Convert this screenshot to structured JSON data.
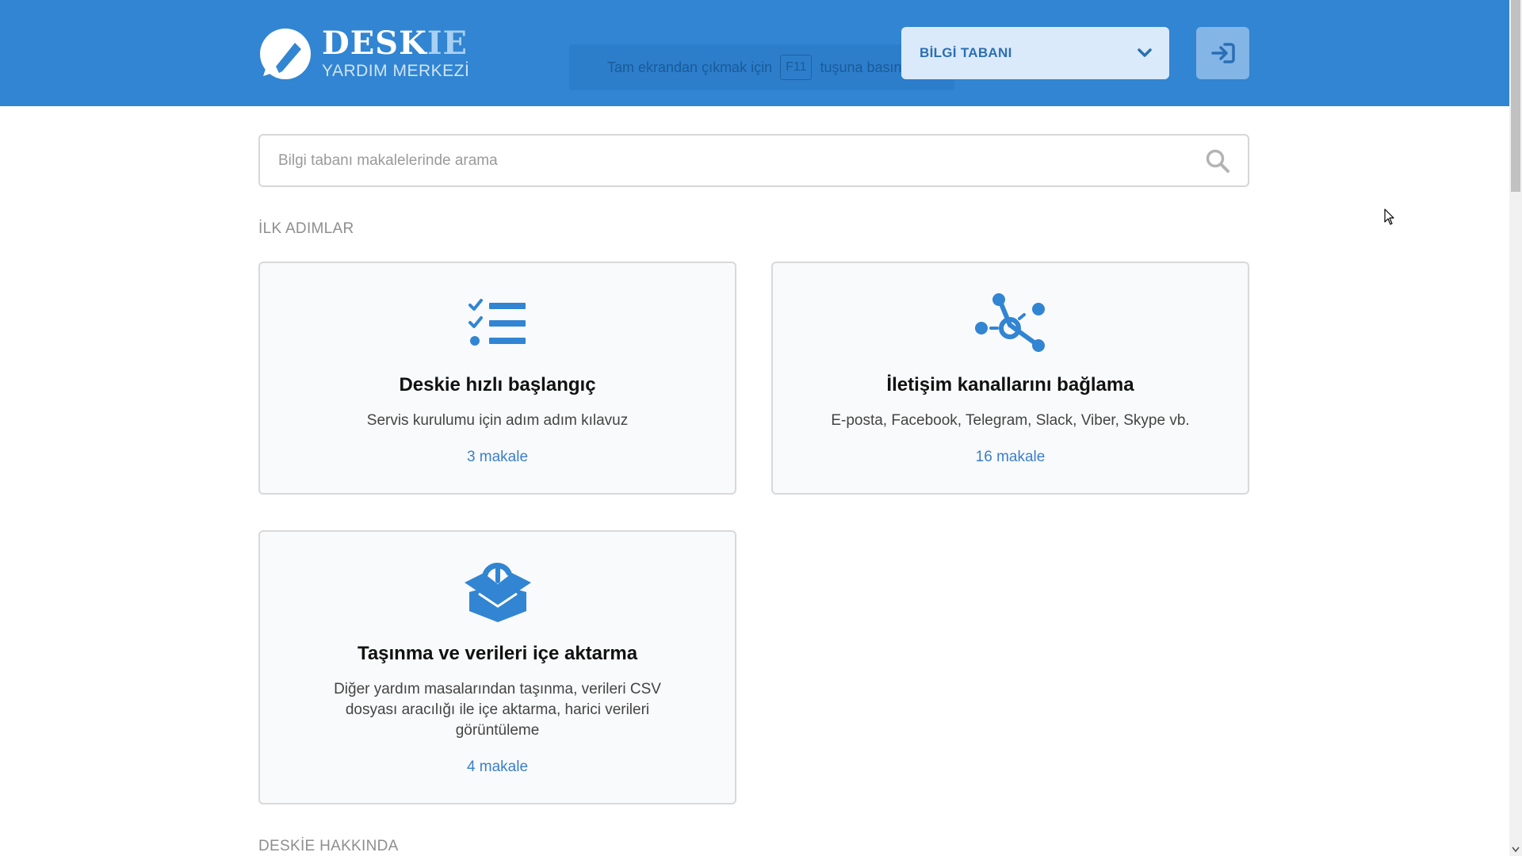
{
  "header": {
    "logo_name_main": "DESK",
    "logo_name_accent": "IE",
    "logo_subtitle": "YARDIM MERKEZİ",
    "fullscreen_hint": {
      "before": "Tam ekrandan çıkmak için",
      "key": "F11",
      "after": "tuşuna basın"
    },
    "kb_select_label": "BİLGİ TABANI",
    "colors": {
      "bar": "#3185d2",
      "select_bg": "#dbeafa",
      "login_bg": "#83b5e6"
    }
  },
  "search": {
    "placeholder": "Bilgi tabanı makalelerinde arama",
    "value": ""
  },
  "sections": [
    {
      "title": "İLK ADIMLAR",
      "cards": [
        {
          "icon": "checklist-icon",
          "title": "Deskie hızlı başlangıç",
          "description": "Servis kurulumu için adım adım kılavuz",
          "count": "3 makale"
        },
        {
          "icon": "network-icon",
          "title": "İletişim kanallarını bağlama",
          "description": "E-posta, Facebook, Telegram, Slack, Viber, Skype vb.",
          "count": "16 makale"
        },
        {
          "icon": "open-box-icon",
          "title": "Taşınma ve verileri içe aktarma",
          "description": "Diğer yardım masalarından taşınma, verileri CSV dosyası aracılığı ile içe aktarma, harici verileri görüntüleme",
          "count": "4 makale"
        }
      ]
    },
    {
      "title": "DESKİE HAKKINDA"
    }
  ],
  "accent_color": "#3a7fcc"
}
